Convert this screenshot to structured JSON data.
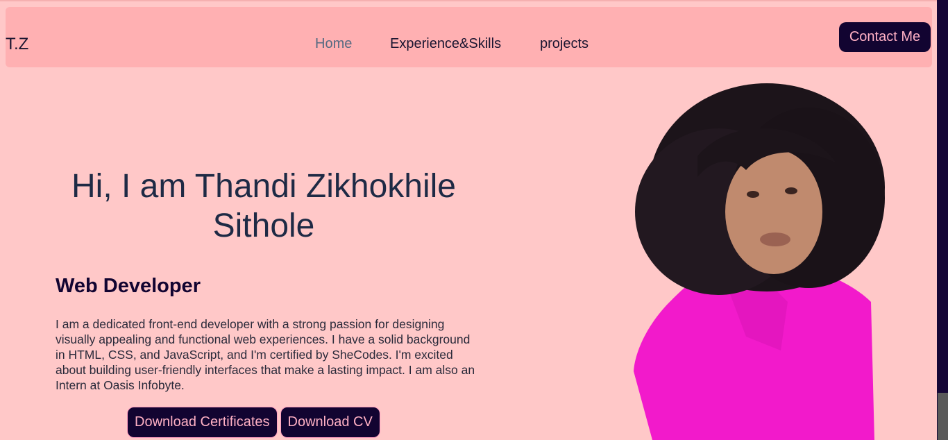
{
  "nav": {
    "brand": "T.Z",
    "links": [
      {
        "label": "Home",
        "active": true
      },
      {
        "label": "Experience&Skills",
        "active": false
      },
      {
        "label": "projects",
        "active": false
      }
    ],
    "contact_label": "Contact Me"
  },
  "hero": {
    "title": "Hi, I am Thandi Zikhokhile Sithole",
    "role": "Web Developer",
    "bio": "I am a dedicated front-end developer with a strong passion for designing visually appealing and functional web experiences. I have a solid background in HTML, CSS, and JavaScript, and I'm certified by SheCodes. I'm excited about building user-friendly interfaces that make a lasting impact. I am also an Intern at Oasis Infobyte.",
    "buttons": {
      "certificates": "Download Certificates",
      "cv": "Download CV"
    }
  },
  "colors": {
    "background": "#ffc8c8",
    "navbar": "#ffb0b2",
    "button_bg": "#120431",
    "button_text": "#ffb0c4",
    "heading": "#1e2a45"
  },
  "icons": {
    "portrait": "profile-photo"
  }
}
